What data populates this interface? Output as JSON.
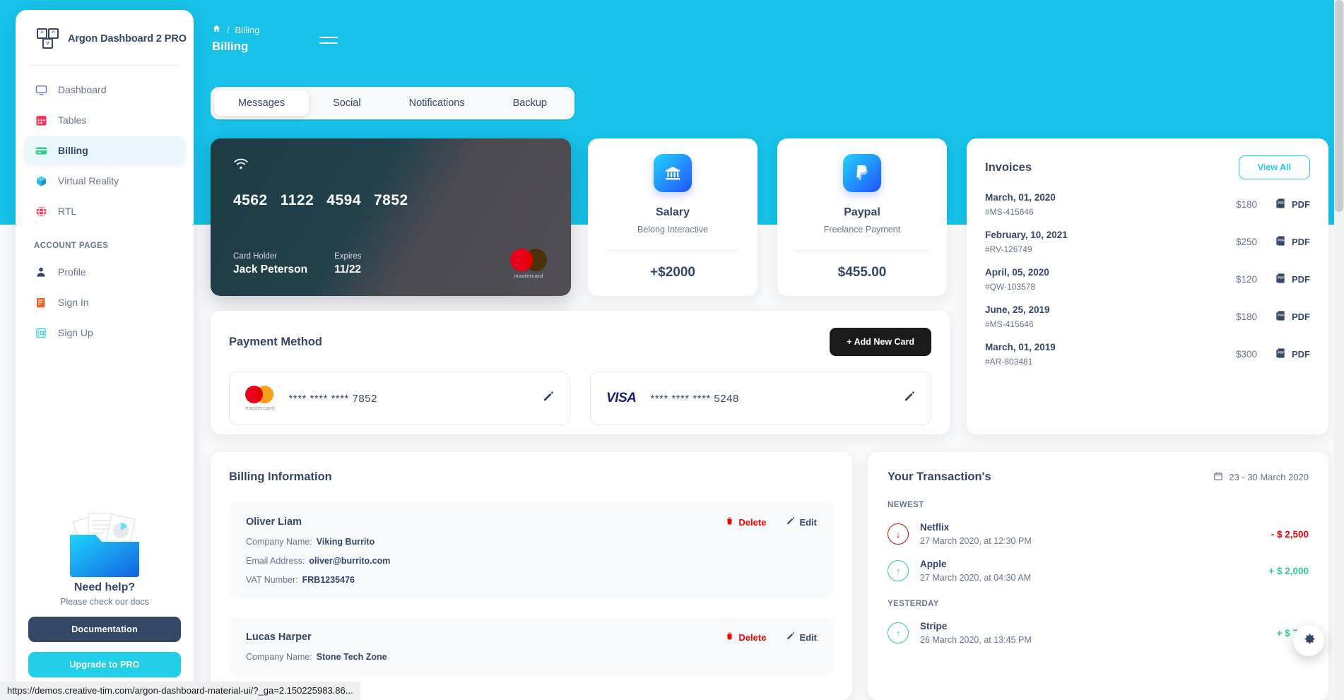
{
  "brand": {
    "name": "Argon Dashboard 2 PRO",
    "logo_icon": "argon-logo-icon"
  },
  "sidebar": {
    "items": [
      {
        "label": "Dashboard",
        "icon": "monitor-icon",
        "active": false
      },
      {
        "label": "Tables",
        "icon": "calendar-icon",
        "active": false
      },
      {
        "label": "Billing",
        "icon": "credit-card-icon",
        "active": true
      },
      {
        "label": "Virtual Reality",
        "icon": "cube-icon",
        "active": false
      },
      {
        "label": "RTL",
        "icon": "globe-icon",
        "active": false
      }
    ],
    "section_label": "ACCOUNT PAGES",
    "account_items": [
      {
        "label": "Profile",
        "icon": "user-icon"
      },
      {
        "label": "Sign In",
        "icon": "sign-in-icon"
      },
      {
        "label": "Sign Up",
        "icon": "sign-up-icon"
      }
    ],
    "help": {
      "title": "Need help?",
      "subtitle": "Please check our docs",
      "documentation_label": "Documentation",
      "upgrade_label": "Upgrade to PRO"
    }
  },
  "header": {
    "home_icon": "home-icon",
    "breadcrumb_separator": "/",
    "breadcrumb": "Billing",
    "title": "Billing",
    "menu_icon": "hamburger-menu-icon"
  },
  "tabs": [
    {
      "label": "Messages",
      "active": true
    },
    {
      "label": "Social",
      "active": false
    },
    {
      "label": "Notifications",
      "active": false
    },
    {
      "label": "Backup",
      "active": false
    }
  ],
  "credit_card": {
    "wifi_icon": "wifi-icon",
    "number_groups": [
      "4562",
      "1122",
      "4594",
      "7852"
    ],
    "holder_label": "Card Holder",
    "holder_value": "Jack Peterson",
    "expires_label": "Expires",
    "expires_value": "11/22",
    "brand_icon": "mastercard-icon",
    "brand_text": "mastercard"
  },
  "stats": [
    {
      "icon": "bank-icon",
      "name": "Salary",
      "sub": "Belong Interactive",
      "amount": "+$2000"
    },
    {
      "icon": "paypal-icon",
      "name": "Paypal",
      "sub": "Freelance Payment",
      "amount": "$455.00"
    }
  ],
  "invoices": {
    "title": "Invoices",
    "view_all_label": "View All",
    "pdf_label": "PDF",
    "pdf_icon": "pdf-file-icon",
    "rows": [
      {
        "date": "March, 01, 2020",
        "id": "#MS-415646",
        "amount": "$180"
      },
      {
        "date": "February, 10, 2021",
        "id": "#RV-126749",
        "amount": "$250"
      },
      {
        "date": "April, 05, 2020",
        "id": "#QW-103578",
        "amount": "$120"
      },
      {
        "date": "June, 25, 2019",
        "id": "#MS-415646",
        "amount": "$180"
      },
      {
        "date": "March, 01, 2019",
        "id": "#AR-803481",
        "amount": "$300"
      }
    ]
  },
  "payment_method": {
    "title": "Payment Method",
    "add_label": "+ Add New Card",
    "cards": [
      {
        "brand": "mastercard",
        "number": "**** **** **** 7852",
        "edit_icon": "pencil-icon"
      },
      {
        "brand": "VISA",
        "number": "**** **** **** 5248",
        "edit_icon": "pencil-icon"
      }
    ]
  },
  "billing_information": {
    "title": "Billing Information",
    "delete_label": "Delete",
    "edit_label": "Edit",
    "delete_icon": "trash-icon",
    "edit_icon": "pencil-icon",
    "entries": [
      {
        "name": "Oliver Liam",
        "company_label": "Company Name:",
        "company_value": "Viking Burrito",
        "email_label": "Email Address:",
        "email_value": "oliver@burrito.com",
        "vat_label": "VAT Number:",
        "vat_value": "FRB1235476"
      },
      {
        "name": "Lucas Harper",
        "company_label": "Company Name:",
        "company_value": "Stone Tech Zone"
      }
    ]
  },
  "transactions": {
    "title": "Your Transaction's",
    "date_range": "23 - 30 March 2020",
    "calendar_icon": "calendar-icon",
    "groups": [
      {
        "label": "NEWEST",
        "items": [
          {
            "name": "Netflix",
            "when": "27 March 2020, at 12:30 PM",
            "amount": "- $ 2,500",
            "direction": "down"
          },
          {
            "name": "Apple",
            "when": "27 March 2020, at 04:30 AM",
            "amount": "+ $ 2,000",
            "direction": "up"
          }
        ]
      },
      {
        "label": "YESTERDAY",
        "items": [
          {
            "name": "Stripe",
            "when": "26 March 2020, at 13:45 PM",
            "amount": "+ $ 750",
            "direction": "up"
          }
        ]
      }
    ]
  },
  "settings_fab": {
    "icon": "gear-icon"
  },
  "statusbar": {
    "url": "https://demos.creative-tim.com/argon-dashboard-material-ui/?_ga=2.150225983.86..."
  },
  "colors": {
    "accent": "#17c1e8",
    "dark": "#344767",
    "muted": "#67748e",
    "danger": "#ea0606",
    "success": "#2dce89",
    "page_bg": "#f8f9fa"
  }
}
